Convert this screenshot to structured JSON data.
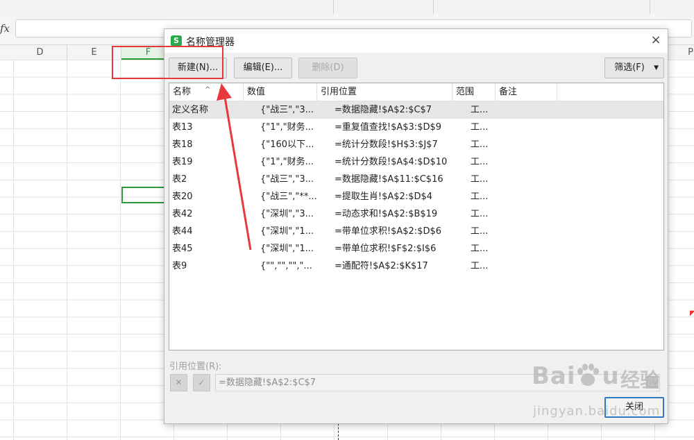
{
  "spreadsheet": {
    "fx_label": "fx",
    "columns": [
      "D",
      "E",
      "F",
      "P"
    ],
    "selected_column": "F",
    "selected_color": "#2a9a3a"
  },
  "dialog": {
    "icon_letter": "S",
    "title": "名称管理器",
    "close_glyph": "×",
    "buttons": {
      "new": "新建(N)...",
      "edit": "编辑(E)...",
      "delete": "删除(D)",
      "filter": "筛选(F)",
      "close": "关闭"
    },
    "list": {
      "headers": [
        "名称",
        "数值",
        "引用位置",
        "范围",
        "备注"
      ],
      "rows": [
        {
          "name": "定义名称",
          "value": "{\"战三\",\"3...",
          "ref": "=数据隐藏!$A$2:$C$7",
          "scope": "工...",
          "note": ""
        },
        {
          "name": "表13",
          "value": "{\"1\",\"财务...",
          "ref": "=重复值查找!$A$3:$D$9",
          "scope": "工...",
          "note": ""
        },
        {
          "name": "表18",
          "value": "{\"160以下...",
          "ref": "=统计分数段!$H$3:$J$7",
          "scope": "工...",
          "note": ""
        },
        {
          "name": "表19",
          "value": "{\"1\",\"财务...",
          "ref": "=统计分数段!$A$4:$D$10",
          "scope": "工...",
          "note": ""
        },
        {
          "name": "表2",
          "value": "{\"战三\",\"3...",
          "ref": "=数据隐藏!$A$11:$C$16",
          "scope": "工...",
          "note": ""
        },
        {
          "name": "表20",
          "value": "{\"战三\",\"**...",
          "ref": "=提取生肖!$A$2:$D$4",
          "scope": "工...",
          "note": ""
        },
        {
          "name": "表42",
          "value": "{\"深圳\",\"3...",
          "ref": "=动态求和!$A$2:$B$19",
          "scope": "工...",
          "note": ""
        },
        {
          "name": "表44",
          "value": "{\"深圳\",\"1...",
          "ref": "=带单位求积!$A$2:$D$6",
          "scope": "工...",
          "note": ""
        },
        {
          "name": "表45",
          "value": "{\"深圳\",\"1...",
          "ref": "=带单位求积!$F$2:$I$6",
          "scope": "工...",
          "note": ""
        },
        {
          "name": "表9",
          "value": "{\"\",\"\",\"\",\"...",
          "ref": "=通配符!$A$2:$K$17",
          "scope": "工...",
          "note": ""
        }
      ],
      "selected_row": 0
    },
    "ref_label": "引用位置(R):",
    "ref_value": "=数据隐藏!$A$2:$C$7",
    "cancel_glyph": "✕",
    "confirm_glyph": "✓"
  },
  "annotation": {
    "color": "#e8383c"
  },
  "watermark": {
    "logo_text": "Bai",
    "logo_suffix": "u",
    "cn_text": "经验",
    "url": "jingyan.baidu.com"
  }
}
